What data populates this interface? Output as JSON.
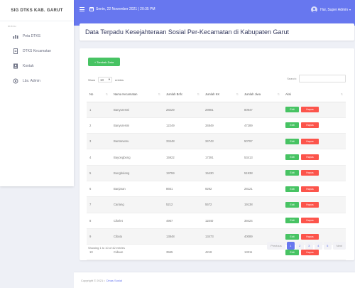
{
  "sidebar": {
    "brand": "SIG DTKS KAB. GARUT",
    "menu_header": "menu",
    "items": [
      {
        "label": "Peta DTKS",
        "icon": "chart-icon"
      },
      {
        "label": "DTKS Kecamatan",
        "icon": "document-icon"
      },
      {
        "label": "Kontak",
        "icon": "contact-icon"
      },
      {
        "label": "Lbs. Admin",
        "icon": "location-icon"
      }
    ]
  },
  "topbar": {
    "datetime": "Senin, 22 November 2021 | 20:35 PM",
    "user": "Hai, Super Admin"
  },
  "page": {
    "title": "Data Terpadu Kesejahteraan Sosial Per-Kecamatan di Kabupaten Garut"
  },
  "controls": {
    "add_label": "+ Tambah Data",
    "show_prefix": "Show",
    "show_value": "10",
    "show_suffix": "entries",
    "search_label": "Search:"
  },
  "table": {
    "headers": [
      "No",
      "Nama Kecamatan",
      "Jumlah Bnfc",
      "Jumlah KK",
      "Jumlah Jiwa",
      "Aksi"
    ],
    "edit_label": "Edit",
    "delete_label": "Hapus",
    "rows": [
      [
        "1",
        "Banyuresmi",
        "28229",
        "28981",
        "80947"
      ],
      [
        "2",
        "Banyuresmi",
        "12249",
        "34849",
        "47289"
      ],
      [
        "3",
        "Bantarwaru",
        "33448",
        "34743",
        "50797"
      ],
      [
        "4",
        "Bayongbong",
        "15922",
        "17391",
        "53413"
      ],
      [
        "5",
        "Bungbulang",
        "19759",
        "15430",
        "51938"
      ],
      [
        "6",
        "Banjaran",
        "8661",
        "9292",
        "28121"
      ],
      [
        "7",
        "Cariang",
        "5212",
        "5572",
        "19138"
      ],
      [
        "8",
        "Cikelet",
        "4967",
        "11840",
        "39424"
      ],
      [
        "9",
        "Cibatu",
        "13848",
        "13473",
        "40089"
      ],
      [
        "10",
        "Cidaun",
        "3565",
        "4218",
        "13311"
      ]
    ]
  },
  "footer_info": "Showing 1 to 10 of 42 entries",
  "pagination": {
    "prev": "Previous",
    "pages": [
      "1",
      "2",
      "3",
      "4",
      "5"
    ],
    "active": "1",
    "next": "Next"
  },
  "footer": {
    "copyright": "Copyright © 2021 •",
    "author": "Dinas Sosial"
  },
  "colors": {
    "primary": "#6777ef",
    "success": "#47c363",
    "danger": "#fc544b"
  }
}
